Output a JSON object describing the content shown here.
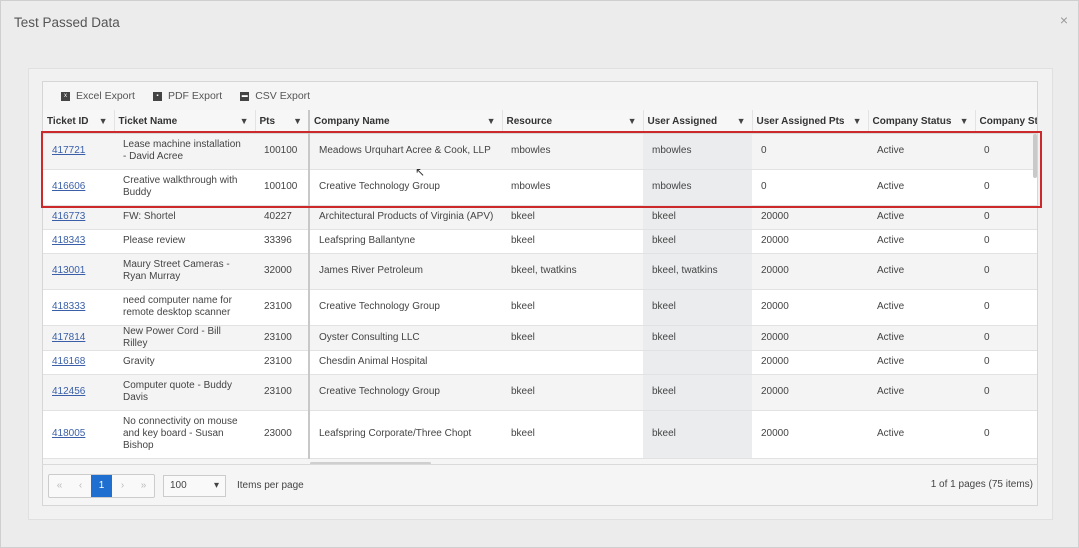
{
  "modal": {
    "title": "Test Passed Data",
    "close": "×"
  },
  "toolbar": {
    "excel_label": "Excel Export",
    "pdf_label": "PDF Export",
    "csv_label": "CSV Export"
  },
  "columns": {
    "ticket_id": "Ticket ID",
    "ticket_name": "Ticket Name",
    "pts": "Pts",
    "company_name": "Company Name",
    "resource": "Resource",
    "user_assigned": "User Assigned",
    "user_assigned_pts": "User Assigned Pts",
    "company_status": "Company Status",
    "company_s": "Company St"
  },
  "rows": [
    {
      "id": "417721",
      "name": "Lease machine installation - David Acree",
      "pts": "100100",
      "company": "Meadows Urquhart Acree & Cook, LLP",
      "resource": "mbowles",
      "user": "mbowles",
      "user_pts": "0",
      "status": "Active",
      "cs": "0"
    },
    {
      "id": "416606",
      "name": "Creative walkthrough with Buddy",
      "pts": "100100",
      "company": "Creative Technology Group",
      "resource": "mbowles",
      "user": "mbowles",
      "user_pts": "0",
      "status": "Active",
      "cs": "0"
    },
    {
      "id": "416773",
      "name": "FW: Shortel",
      "pts": "40227",
      "company": "Architectural Products of Virginia (APV)",
      "resource": "bkeel",
      "user": "bkeel",
      "user_pts": "20000",
      "status": "Active",
      "cs": "0"
    },
    {
      "id": "418343",
      "name": "Please review",
      "pts": "33396",
      "company": "Leafspring Ballantyne",
      "resource": "bkeel",
      "user": "bkeel",
      "user_pts": "20000",
      "status": "Active",
      "cs": "0"
    },
    {
      "id": "413001",
      "name": "Maury Street Cameras - Ryan Murray",
      "pts": "32000",
      "company": "James River Petroleum",
      "resource": "bkeel, twatkins",
      "user": "bkeel, twatkins",
      "user_pts": "20000",
      "status": "Active",
      "cs": "0"
    },
    {
      "id": "418333",
      "name": "need computer name for remote desktop scanner",
      "pts": "23100",
      "company": "Creative Technology Group",
      "resource": "bkeel",
      "user": "bkeel",
      "user_pts": "20000",
      "status": "Active",
      "cs": "0"
    },
    {
      "id": "417814",
      "name": "New Power Cord - Bill Rilley",
      "pts": "23100",
      "company": "Oyster Consulting LLC",
      "resource": "bkeel",
      "user": "bkeel",
      "user_pts": "20000",
      "status": "Active",
      "cs": "0"
    },
    {
      "id": "416168",
      "name": "Gravity",
      "pts": "23100",
      "company": "Chesdin Animal Hospital",
      "resource": "",
      "user": "",
      "user_pts": "20000",
      "status": "Active",
      "cs": "0"
    },
    {
      "id": "412456",
      "name": "Computer quote - Buddy Davis",
      "pts": "23100",
      "company": "Creative Technology Group",
      "resource": "bkeel",
      "user": "bkeel",
      "user_pts": "20000",
      "status": "Active",
      "cs": "0"
    },
    {
      "id": "418005",
      "name": "No connectivity on mouse and key board - Susan Bishop",
      "pts": "23000",
      "company": "Leafspring Corporate/Three Chopt",
      "resource": "bkeel",
      "user": "bkeel",
      "user_pts": "20000",
      "status": "Active",
      "cs": "0"
    }
  ],
  "pager": {
    "first": "«",
    "prev": "‹",
    "page": "1",
    "next": "›",
    "last": "»",
    "page_size": "100",
    "items_label": "Items per page",
    "info": "1 of 1 pages (75 items)"
  }
}
